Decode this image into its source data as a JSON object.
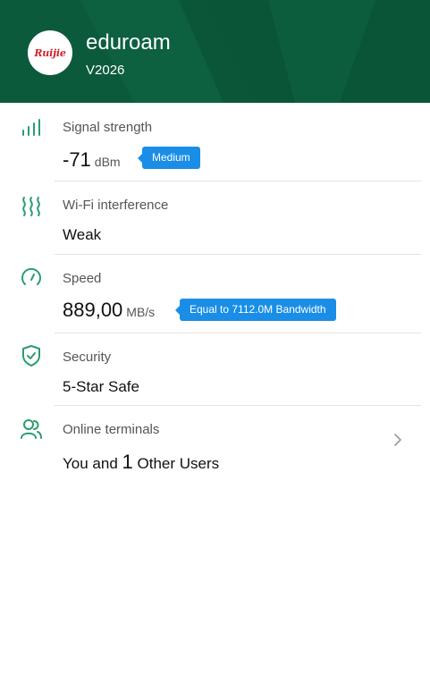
{
  "header": {
    "ssid": "eduroam",
    "version": "V2026",
    "logo_text": "Ruijie",
    "background_color": "#0c5a3c",
    "logo_icon": "ruijie-logo"
  },
  "accent_color": "#2a9d6e",
  "badge_color": "#1a8ee6",
  "signal": {
    "label": "Signal strength",
    "value": "-71",
    "unit": "dBm",
    "badge": "Medium",
    "icon": "signal-bars-icon"
  },
  "interference": {
    "label": "Wi-Fi interference",
    "value": "Weak",
    "icon": "interference-waves-icon"
  },
  "speed": {
    "label": "Speed",
    "value": "889,00",
    "unit": "MB/s",
    "badge": "Equal to 7112.0M Bandwidth",
    "icon": "speedometer-icon"
  },
  "security": {
    "label": "Security",
    "value": "5-Star Safe",
    "icon": "shield-check-icon"
  },
  "terminals": {
    "label": "Online terminals",
    "prefix": "You and",
    "count": "1",
    "suffix": "Other Users",
    "icon": "users-icon",
    "action_icon": "chevron-right-icon"
  }
}
